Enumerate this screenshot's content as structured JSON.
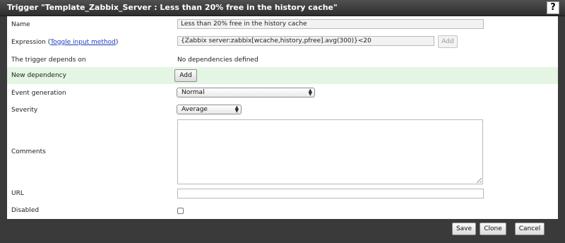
{
  "dialog": {
    "title": "Trigger \"Template_Zabbix_Server : Less than 20% free in the history cache\"",
    "help_icon": "?"
  },
  "form": {
    "name": {
      "label": "Name",
      "value": "Less than 20% free in the history cache"
    },
    "expression": {
      "label_prefix": "Expression (",
      "toggle_link": "Toggle input method",
      "label_suffix": ")",
      "value": "{Zabbix server:zabbix[wcache,history,pfree].avg(300)}<20",
      "add_button": "Add"
    },
    "depends_on": {
      "label": "The trigger depends on",
      "value": "No dependencies defined"
    },
    "new_dependency": {
      "label": "New dependency",
      "add_button": "Add"
    },
    "event_generation": {
      "label": "Event generation",
      "selected": "Normal"
    },
    "severity": {
      "label": "Severity",
      "selected": "Average"
    },
    "comments": {
      "label": "Comments",
      "value": ""
    },
    "url": {
      "label": "URL",
      "value": ""
    },
    "disabled": {
      "label": "Disabled",
      "checked": false
    }
  },
  "footer": {
    "save": "Save",
    "clone": "Clone",
    "cancel": "Cancel"
  },
  "colors": {
    "highlight_row": "#e4f5e4",
    "link": "#1a3dbd"
  }
}
